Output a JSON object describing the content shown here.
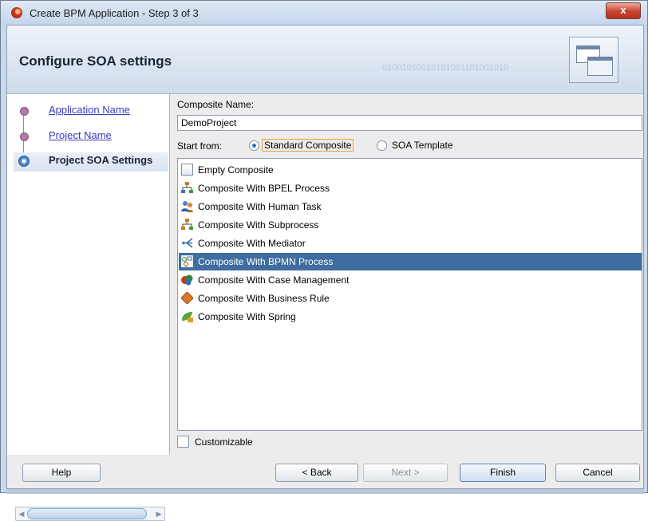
{
  "window": {
    "title": "Create BPM Application - Step 3 of 3",
    "close_glyph": "x"
  },
  "header": {
    "title": "Configure SOA settings",
    "decoration_text": "01001010010101001101001010"
  },
  "navigation": {
    "items": [
      {
        "label": "Application Name",
        "state": "visited"
      },
      {
        "label": "Project Name",
        "state": "visited"
      },
      {
        "label": "Project SOA Settings",
        "state": "current"
      }
    ]
  },
  "composite_name": {
    "label": "Composite Name:",
    "value": "DemoProject"
  },
  "start_from": {
    "label": "Start from:",
    "options": [
      {
        "label": "Standard Composite",
        "checked": true
      },
      {
        "label": "SOA Template",
        "checked": false
      }
    ]
  },
  "templates": [
    {
      "label": "Empty Composite",
      "icon": "empty-composite-icon"
    },
    {
      "label": "Composite With BPEL Process",
      "icon": "bpel-process-icon"
    },
    {
      "label": "Composite With Human Task",
      "icon": "human-task-icon"
    },
    {
      "label": "Composite With Subprocess",
      "icon": "subprocess-icon"
    },
    {
      "label": "Composite With Mediator",
      "icon": "mediator-icon"
    },
    {
      "label": "Composite With BPMN Process",
      "icon": "bpmn-process-icon",
      "selected": true
    },
    {
      "label": "Composite With Case Management",
      "icon": "case-management-icon"
    },
    {
      "label": "Composite With Business Rule",
      "icon": "business-rule-icon"
    },
    {
      "label": "Composite With Spring",
      "icon": "spring-icon"
    }
  ],
  "customizable": {
    "label": "Customizable",
    "checked": false
  },
  "buttons": {
    "help": "Help",
    "back": "< Back",
    "next": "Next >",
    "finish": "Finish",
    "cancel": "Cancel"
  },
  "colors": {
    "selection": "#3f6d9f",
    "link": "#3a3abf",
    "train_dot": "#b27aa8"
  }
}
